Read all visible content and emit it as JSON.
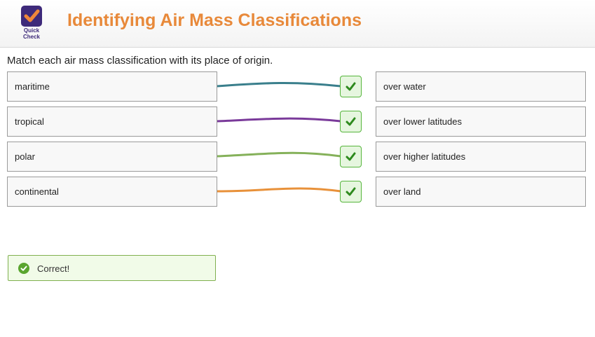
{
  "header": {
    "logo_text_line1": "Quick",
    "logo_text_line2": "Check",
    "title": "Identifying Air Mass Classifications"
  },
  "prompt": "Match each air mass classification with its place of origin.",
  "left_items": [
    "maritime",
    "tropical",
    "polar",
    "continental"
  ],
  "right_items": [
    "over water",
    "over lower latitudes",
    "over higher latitudes",
    "over land"
  ],
  "matches": [
    {
      "left": "maritime",
      "right": "over water",
      "line_color": "#3a7f8c",
      "correct": true
    },
    {
      "left": "tropical",
      "right": "over lower latitudes",
      "line_color": "#7a3a9a",
      "correct": true
    },
    {
      "left": "polar",
      "right": "over higher latitudes",
      "line_color": "#85b15a",
      "correct": true
    },
    {
      "left": "continental",
      "right": "over land",
      "line_color": "#e8913a",
      "correct": true
    }
  ],
  "feedback": {
    "text": "Correct!"
  },
  "colors": {
    "title": "#e8893a",
    "brand": "#3e2a7a",
    "check_border": "#55b53b",
    "check_fill": "#e6f6df",
    "check_mark": "#2e8a1e"
  },
  "icons": {
    "logo": "quick-check-logo-icon",
    "match_check": "checkmark-icon",
    "feedback": "check-circle-icon"
  }
}
